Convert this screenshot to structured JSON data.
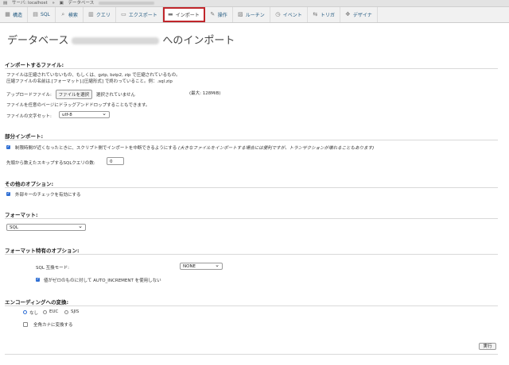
{
  "breadcrumb": {
    "server": "サーバ: localhost",
    "database": "データベース"
  },
  "tabs": [
    {
      "label": "構造",
      "icon": "table-icon"
    },
    {
      "label": "SQL",
      "icon": "sql-icon"
    },
    {
      "label": "検索",
      "icon": "search-icon"
    },
    {
      "label": "クエリ",
      "icon": "query-icon"
    },
    {
      "label": "エクスポート",
      "icon": "export-icon"
    },
    {
      "label": "インポート",
      "icon": "import-icon",
      "active": true
    },
    {
      "label": "操作",
      "icon": "wrench-icon"
    },
    {
      "label": "ルーチン",
      "icon": "routine-icon"
    },
    {
      "label": "イベント",
      "icon": "clock-icon"
    },
    {
      "label": "トリガ",
      "icon": "trigger-icon"
    },
    {
      "label": "デザイナ",
      "icon": "designer-icon"
    }
  ],
  "page": {
    "title_prefix": "データベース",
    "title_suffix": "へのインポート"
  },
  "file_section": {
    "heading": "インポートするファイル:",
    "line1": "ファイルは圧縮されていないもの、もしくは、gzip, bzip2, zip で圧縮されているもの。",
    "line2": "圧縮ファイルの名前は.[フォーマット].[圧縮形式] で終わっていること。例：.sql.zip",
    "upload_label": "アップロードファイル:",
    "choose_button": "ファイルを選択",
    "no_file": "選択されていません",
    "max_size": "(最大: 128MiB)",
    "drag_hint": "ファイルを任意のページにドラッグアンドドロップすることもできます。",
    "charset_label": "ファイルの文字セット:",
    "charset_value": "utf-8"
  },
  "partial_section": {
    "heading": "部分インポート:",
    "interrupt_label": "制限時間が近くなったときに、スクリプト側でインポートを中断できるようにする",
    "interrupt_note": "(大きなファイルをインポートする場合には便利ですが、トランザクションが壊れることもあります)",
    "skip_label": "先頭から数えたスキップするSQLクエリの数:",
    "skip_value": "0"
  },
  "other_section": {
    "heading": "その他のオプション:",
    "fk_label": "外部キーのチェックを有効にする"
  },
  "format_section": {
    "heading": "フォーマット:",
    "format_value": "SQL"
  },
  "format_options_section": {
    "heading": "フォーマット特有のオプション:",
    "compat_label": "SQL 互換モード:",
    "compat_value": "NONE",
    "auto_inc_label": "値がゼロのものに対して AUTO_INCREMENT を使用しない"
  },
  "encoding_section": {
    "heading": "エンコーディングへの変換:",
    "opt_none": "なし",
    "opt_euc": "EUC",
    "opt_sjis": "SJIS",
    "kana_label": "全角カナに変換する"
  },
  "go_button": "実行",
  "colors": {
    "accent": "#c0262b",
    "link": "#235a81",
    "checkbox": "#2f6fd4"
  }
}
